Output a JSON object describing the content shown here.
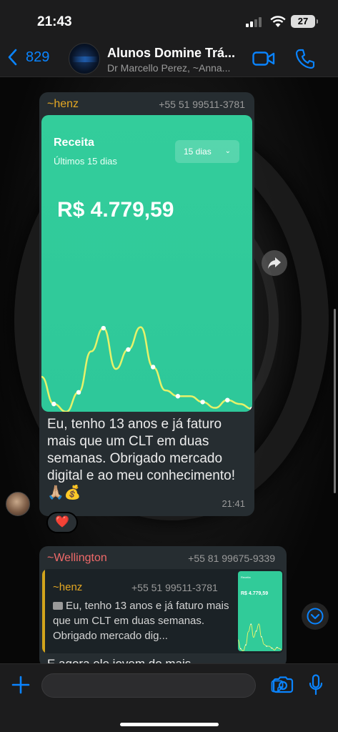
{
  "status": {
    "time": "21:43",
    "battery": "27"
  },
  "header": {
    "back_count": "829",
    "title": "Alunos Domine Trá...",
    "subtitle": "Dr Marcello Perez, ~Anna...",
    "avatar_icon": "group-logo-icon"
  },
  "messages": [
    {
      "sender": "~henz",
      "phone": "+55 51 99511-3781",
      "image": {
        "title": "Receita",
        "subtitle": "Últimos 15 dias",
        "period_select": "15 dias",
        "value": "R$ 4.779,59",
        "colors": {
          "background": "#33cd9b",
          "line": "#e6f26a",
          "point": "#ffffff"
        }
      },
      "text": "Eu, tenho 13 anos e já faturo mais que um CLT em duas semanas. Obrigado mercado digital e ao meu conhecimento!🙏🏼💰",
      "time": "21:41",
      "reaction": "❤️"
    },
    {
      "sender": "~Wellington",
      "phone": "+55 81 99675-9339",
      "quote": {
        "sender": "~henz",
        "phone": "+55 51 99511-3781",
        "text": "Eu, tenho 13 anos e já faturo mais que um CLT em duas semanas. Obrigado mercado dig...",
        "thumb_title": "Receita",
        "thumb_value": "R$ 4.779,59"
      },
      "text_partial": "E agora ele jovem do mais"
    }
  ],
  "chart_data": {
    "type": "line",
    "title": "",
    "series": [
      {
        "values": [
          36,
          8,
          0,
          20,
          62,
          86,
          44,
          64,
          87,
          46,
          22,
          16,
          16,
          10,
          4,
          12,
          8,
          3
        ]
      }
    ],
    "ylim": [
      0,
      100
    ],
    "grid": false,
    "legend": "none"
  },
  "icons": {
    "back": "chevron-left-icon",
    "video": "video-camera-icon",
    "call": "phone-icon",
    "forward": "share-forward-icon",
    "scroll_down": "chevron-down-circle-icon",
    "plus": "plus-icon",
    "sticker": "sticker-icon",
    "camera": "camera-icon",
    "mic": "microphone-icon"
  },
  "accent": "#0a84ff"
}
